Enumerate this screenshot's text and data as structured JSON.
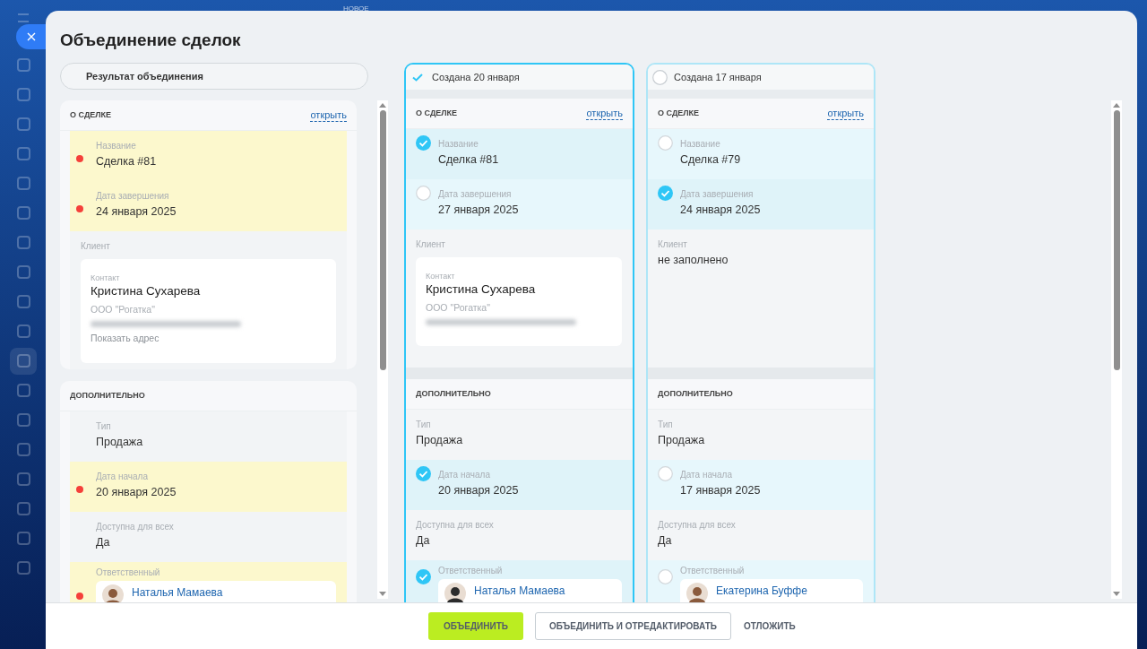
{
  "app_background": {
    "top_label": "НОВОЕ"
  },
  "dialog": {
    "title": "Объединение сделок"
  },
  "columns": [
    {
      "kind": "result",
      "header": "Результат объединения",
      "sections": [
        {
          "title": "О СДЕЛКЕ",
          "link": "открыть",
          "fields": [
            {
              "kind": "text",
              "label": "Название",
              "value": "Сделка #81",
              "conflict": true
            },
            {
              "kind": "text",
              "label": "Дата завершения",
              "value": "24 января 2025",
              "conflict": true
            },
            {
              "kind": "contact",
              "label": "Клиент",
              "conflict": false,
              "contact": {
                "caption": "Контакт",
                "name": "Кристина Сухарева",
                "company": "ООО \"Рогатка\"",
                "address_link": "Показать адрес"
              }
            }
          ]
        },
        {
          "title": "ДОПОЛНИТЕЛЬНО",
          "fields": [
            {
              "kind": "text",
              "label": "Тип",
              "value": "Продажа",
              "conflict": false
            },
            {
              "kind": "text",
              "label": "Дата начала",
              "value": "20 января 2025",
              "conflict": true
            },
            {
              "kind": "text",
              "label": "Доступна для всех",
              "value": "Да",
              "conflict": false
            },
            {
              "kind": "person",
              "label": "Ответственный",
              "value": "Наталья Мамаева",
              "conflict": true
            }
          ]
        }
      ]
    },
    {
      "kind": "source",
      "header": "Создана 20 января",
      "selected": true,
      "sections": [
        {
          "title": "О СДЕЛКЕ",
          "link": "открыть",
          "fields": [
            {
              "kind": "text",
              "label": "Название",
              "value": "Сделка #81",
              "checked": true
            },
            {
              "kind": "text",
              "label": "Дата завершения",
              "value": "27 января 2025",
              "checked": false
            },
            {
              "kind": "contact",
              "label": "Клиент",
              "contact": {
                "caption": "Контакт",
                "name": "Кристина Сухарева",
                "company": "ООО \"Рогатка\""
              }
            }
          ]
        },
        {
          "title": "ДОПОЛНИТЕЛЬНО",
          "fields": [
            {
              "kind": "text",
              "label": "Тип",
              "value": "Продажа"
            },
            {
              "kind": "text",
              "label": "Дата начала",
              "value": "20 января 2025",
              "checked": true
            },
            {
              "kind": "text",
              "label": "Доступна для всех",
              "value": "Да"
            },
            {
              "kind": "person",
              "label": "Ответственный",
              "value": "Наталья Мамаева",
              "checked": true
            }
          ]
        }
      ]
    },
    {
      "kind": "source",
      "header": "Создана 17 января",
      "selected": false,
      "sections": [
        {
          "title": "О СДЕЛКЕ",
          "link": "открыть",
          "fields": [
            {
              "kind": "text",
              "label": "Название",
              "value": "Сделка #79",
              "checked": false
            },
            {
              "kind": "text",
              "label": "Дата завершения",
              "value": "24 января 2025",
              "checked": true
            },
            {
              "kind": "empty",
              "label": "Клиент",
              "value": "не заполнено"
            }
          ]
        },
        {
          "title": "ДОПОЛНИТЕЛЬНО",
          "fields": [
            {
              "kind": "text",
              "label": "Тип",
              "value": "Продажа"
            },
            {
              "kind": "text",
              "label": "Дата начала",
              "value": "17 января 2025",
              "checked": false
            },
            {
              "kind": "text",
              "label": "Доступна для всех",
              "value": "Да"
            },
            {
              "kind": "person",
              "label": "Ответственный",
              "value": "Екатерина Буффе",
              "checked": false
            }
          ]
        }
      ]
    }
  ],
  "buttons": [
    {
      "kind": "primary",
      "label": "ОБЪЕДИНИТЬ"
    },
    {
      "kind": "outline",
      "label": "ОБЪЕДИНИТЬ И ОТРЕДАКТИРОВАТЬ"
    },
    {
      "kind": "plain",
      "label": "ОТЛОЖИТЬ"
    }
  ]
}
